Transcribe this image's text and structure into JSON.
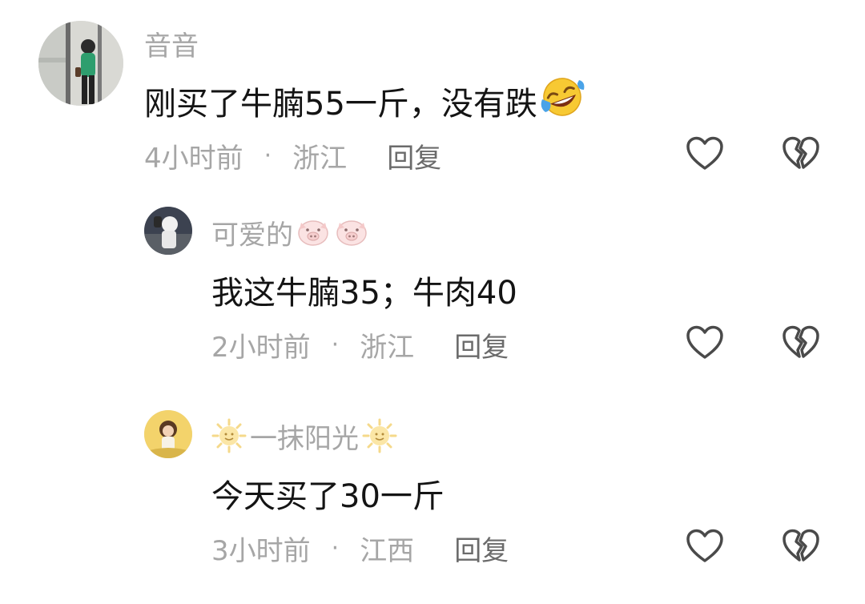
{
  "comments": [
    {
      "username": "音音",
      "content": "刚买了牛腩55一斤，没有跌",
      "time": "4小时前",
      "separator": "·",
      "location": "浙江",
      "reply_label": "回复",
      "emoji": "rolling-on-floor-laughing-emoji"
    },
    {
      "username": "可爱的",
      "username_emoji": "pig-face-emoji",
      "content": "我这牛腩35；牛肉40",
      "time": "2小时前",
      "separator": "·",
      "location": "浙江",
      "reply_label": "回复"
    },
    {
      "username": "一抹阳光",
      "username_emoji": "sun-with-face-emoji",
      "content": "今天买了30一斤",
      "time": "3小时前",
      "separator": "·",
      "location": "江西",
      "reply_label": "回复"
    }
  ],
  "icons": {
    "like": "heart-outline-icon",
    "dislike": "broken-heart-icon"
  },
  "colors": {
    "username": "#a6a6a6",
    "content": "#141414",
    "meta": "#a6a6a6",
    "reply": "#6b6b6b",
    "icon": "#4a4a4a"
  }
}
